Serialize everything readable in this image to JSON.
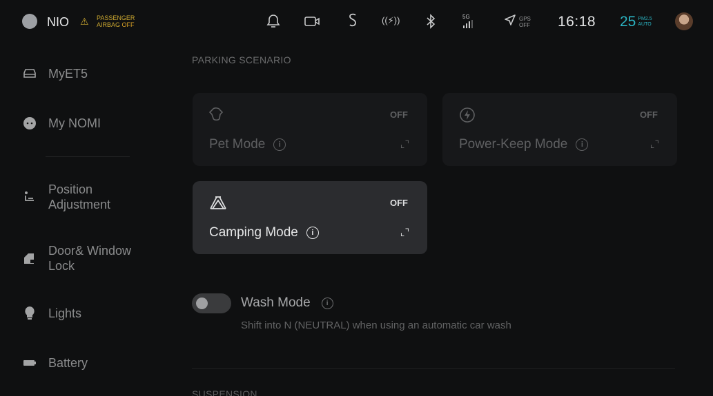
{
  "status_bar": {
    "brand": "NIO",
    "airbag_line1": "PASSENGER",
    "airbag_line2": "AIRBAG",
    "airbag_state": "OFF",
    "network": "5G",
    "gps_line1": "GPS",
    "gps_line2": "OFF",
    "time": "16:18",
    "pm_value": "25",
    "pm_line1": "PM2.5",
    "pm_line2": "AUTO",
    "icons": [
      "bell-icon",
      "dashcam-icon",
      "nomi-s-icon",
      "wireless-charge-icon",
      "bluetooth-icon",
      "signal-icon",
      "navigation-arrow-icon"
    ]
  },
  "sidebar": {
    "items": [
      {
        "label": "MyET5",
        "icon": "car-icon"
      },
      {
        "label": "My NOMI",
        "icon": "nomi-face-icon"
      },
      {
        "label": "Position\nAdjustment",
        "icon": "seat-icon"
      },
      {
        "label": "Door& Window\nLock",
        "icon": "door-lock-icon"
      },
      {
        "label": "Lights",
        "icon": "bulb-icon"
      },
      {
        "label": "Battery",
        "icon": "battery-icon"
      }
    ]
  },
  "main": {
    "section_title": "PARKING SCENARIO",
    "cards": [
      {
        "title": "Pet Mode",
        "status": "OFF",
        "icon": "pet-icon",
        "active": false
      },
      {
        "title": "Power-Keep Mode",
        "status": "OFF",
        "icon": "power-icon",
        "active": false
      },
      {
        "title": "Camping Mode",
        "status": "OFF",
        "icon": "tent-icon",
        "active": true
      }
    ],
    "wash": {
      "title": "Wash Mode",
      "description": "Shift into N (NEUTRAL) when using an automatic car wash",
      "enabled": false
    },
    "next_section_title": "SUSPENSION"
  }
}
